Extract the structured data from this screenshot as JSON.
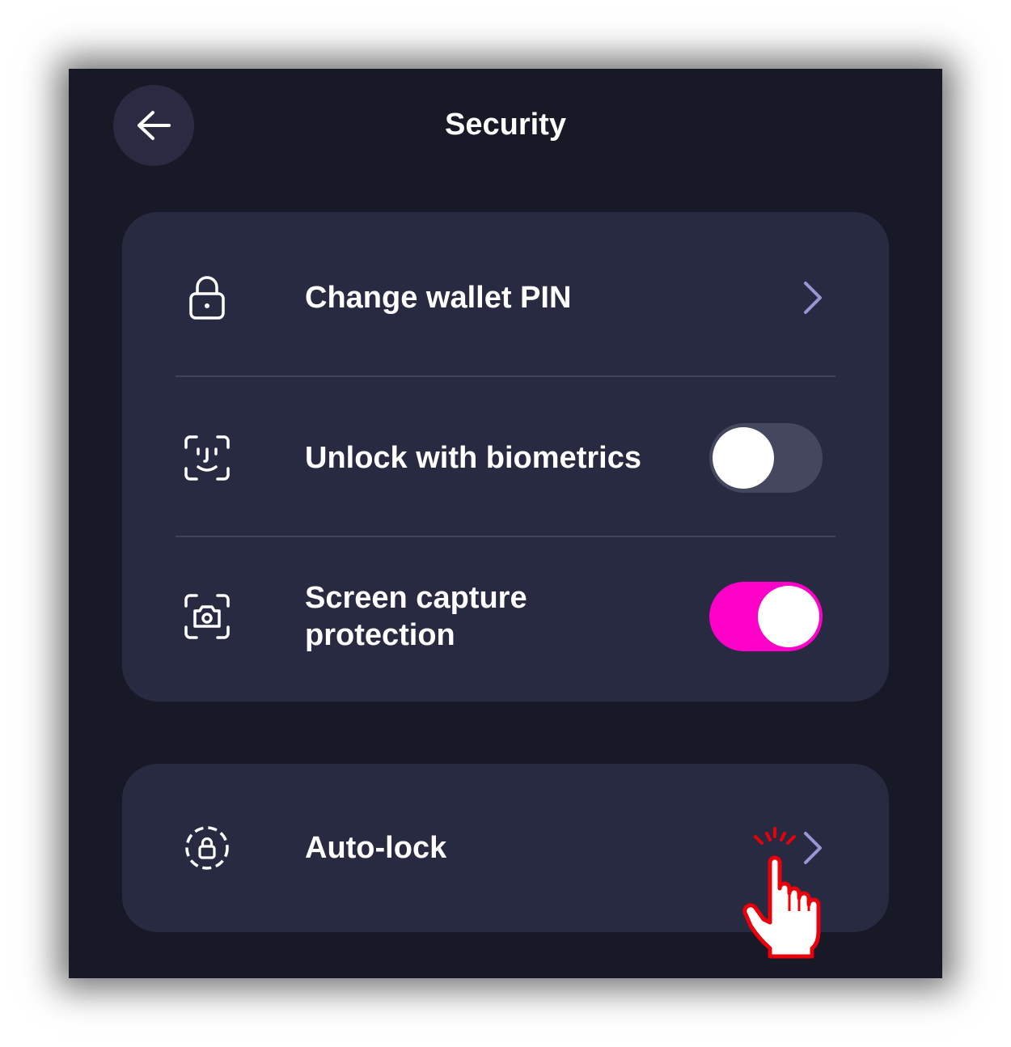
{
  "header": {
    "title": "Security",
    "back_icon": "arrow-left-icon"
  },
  "settings": {
    "change_pin": {
      "label": "Change wallet PIN",
      "icon": "lock-icon"
    },
    "biometrics": {
      "label": "Unlock with biometrics",
      "icon": "face-id-icon",
      "enabled": false
    },
    "screen_capture": {
      "label": "Screen capture protection",
      "icon": "camera-scan-icon",
      "enabled": true
    },
    "auto_lock": {
      "label": "Auto-lock",
      "icon": "lock-timer-icon"
    }
  },
  "colors": {
    "background": "#181926",
    "card": "#282a42",
    "accent": "#ff00c8",
    "chevron": "#9a96d6"
  }
}
